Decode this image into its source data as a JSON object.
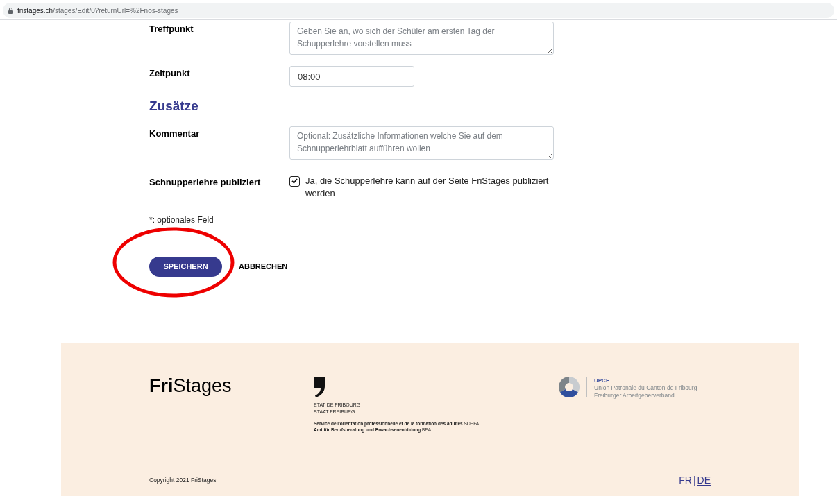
{
  "address_bar": {
    "host": "fristages.ch",
    "path": "/stages/Edit/0?returnUrl=%2Fnos-stages"
  },
  "fields": [
    {
      "kind": "textarea",
      "label": "Treffpunkt",
      "placeholder": "Geben Sie an, wo sich der Schüler am ersten Tag der Schupperlehre vorstellen muss"
    },
    {
      "kind": "input",
      "label": "Zeitpunkt",
      "value": "08:00"
    }
  ],
  "section_heading": "Zusätze",
  "extra_fields": [
    {
      "kind": "textarea",
      "label": "Kommentar",
      "placeholder": "Optional: Zusätzliche Informationen welche Sie auf dem Schnupperlehrblatt aufführen wollen"
    },
    {
      "kind": "checkbox",
      "label": "Schnupperlehre publiziert",
      "option": "Ja, die Schupperlehre kann auf der Seite FriStages publiziert werden",
      "checked": true
    }
  ],
  "note": "*: optionales Feld",
  "buttons": [
    {
      "kind": "primary",
      "label": "SPEICHERN"
    },
    {
      "kind": "text",
      "label": "ABBRECHEN"
    }
  ],
  "annotation": {
    "kind": "ellipse",
    "color": "#ee0000"
  },
  "footer": {
    "logo_bold": "Fri",
    "logo_rest": "Stages",
    "state_lines": [
      "ETAT DE FRIBOURG",
      "STAAT FREIBURG"
    ],
    "service_lines": [
      {
        "bold": "Service de l'orientation professionnelle et de la formation des adultes",
        "abbr": "SOPFA"
      },
      {
        "bold": "Amt für Berufsberatung und Erwachsenenbildung",
        "abbr": "BEA"
      }
    ],
    "partner_title": "UPCF",
    "partner_lines": [
      "Union Patronale du Canton de Fribourg",
      "Freiburger Arbeitgeberverband"
    ],
    "copyright": "Copyright 2021 FriStages",
    "languages": [
      {
        "label": "FR",
        "selected": false
      },
      {
        "label": "DE",
        "selected": true
      }
    ],
    "language_separator": "|"
  }
}
